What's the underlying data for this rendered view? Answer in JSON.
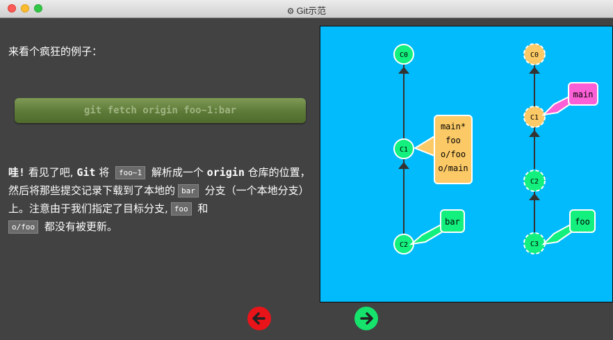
{
  "window": {
    "title": "Git示范",
    "title_icon": "gear-icon"
  },
  "left": {
    "intro": "来看个疯狂的例子：",
    "command": "git fetch origin foo~1:bar",
    "paragraph": {
      "t1": "哇!",
      "t2": " 看见了吧,",
      "t3": "Git",
      "t4": " 将 ",
      "c1": "foo~1",
      "t5": " 解析成一个 ",
      "t6": "origin",
      "t7": " 仓库的位置，然后将那些提交记录下载到了本地的",
      "c2": "bar",
      "t8": " 分支（一个本地分支）上。注意由于我们指定了目标分支,",
      "c3": "foo",
      "t9": " 和 ",
      "c4": "o/foo",
      "t10": " 都没有被更新。"
    }
  },
  "graph": {
    "colors": {
      "background": "#01bbfc",
      "commit_green": "#13f07e",
      "commit_orange": "#fbc966",
      "main_pink": "#fa5fd6",
      "line": "#333333"
    },
    "local": {
      "commits": [
        "C0",
        "C1",
        "C2"
      ],
      "labels": {
        "multi": [
          "main*",
          "foo",
          "o/foo",
          "o/main"
        ],
        "bar": "bar"
      }
    },
    "remote": {
      "commits": [
        "C0",
        "C1",
        "C2",
        "C3"
      ],
      "labels": {
        "main": "main",
        "foo": "foo"
      }
    }
  },
  "navigation": {
    "prev_icon": "arrow-left-icon",
    "next_icon": "arrow-right-icon"
  }
}
